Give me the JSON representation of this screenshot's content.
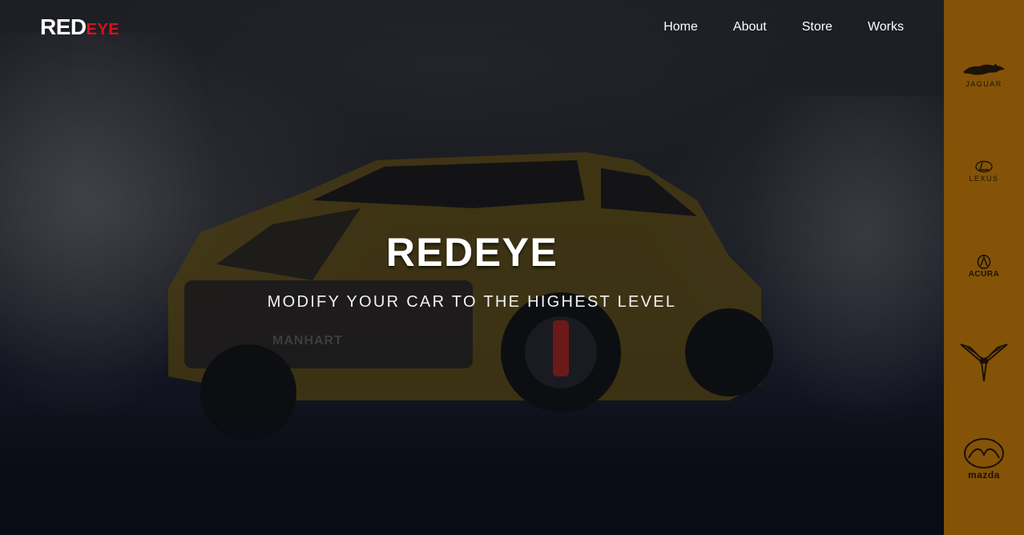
{
  "header": {
    "logo_primary": "RED",
    "logo_secondary": "EYE",
    "nav": [
      {
        "label": "Home"
      },
      {
        "label": "About"
      },
      {
        "label": "Store"
      },
      {
        "label": "Works"
      }
    ]
  },
  "hero": {
    "title": "REDEYE",
    "subtitle": "MODIFY YOUR CAR TO THE HIGHEST LEVEL",
    "car_plate_text": "MANHART"
  },
  "brands": [
    {
      "name": "JAGUAR",
      "icon": "jaguar-logo-icon"
    },
    {
      "name": "LEXUS",
      "icon": "lexus-logo-icon"
    },
    {
      "name": "ACURA",
      "icon": "acura-logo-icon"
    },
    {
      "name": "",
      "icon": "corvette-logo-icon"
    },
    {
      "name": "mazda",
      "icon": "mazda-logo-icon"
    }
  ],
  "colors": {
    "accent_red": "#d8131a",
    "brand_bar": "#845307",
    "background": "#0c0e14",
    "car_yellow": "#8a6a10"
  }
}
